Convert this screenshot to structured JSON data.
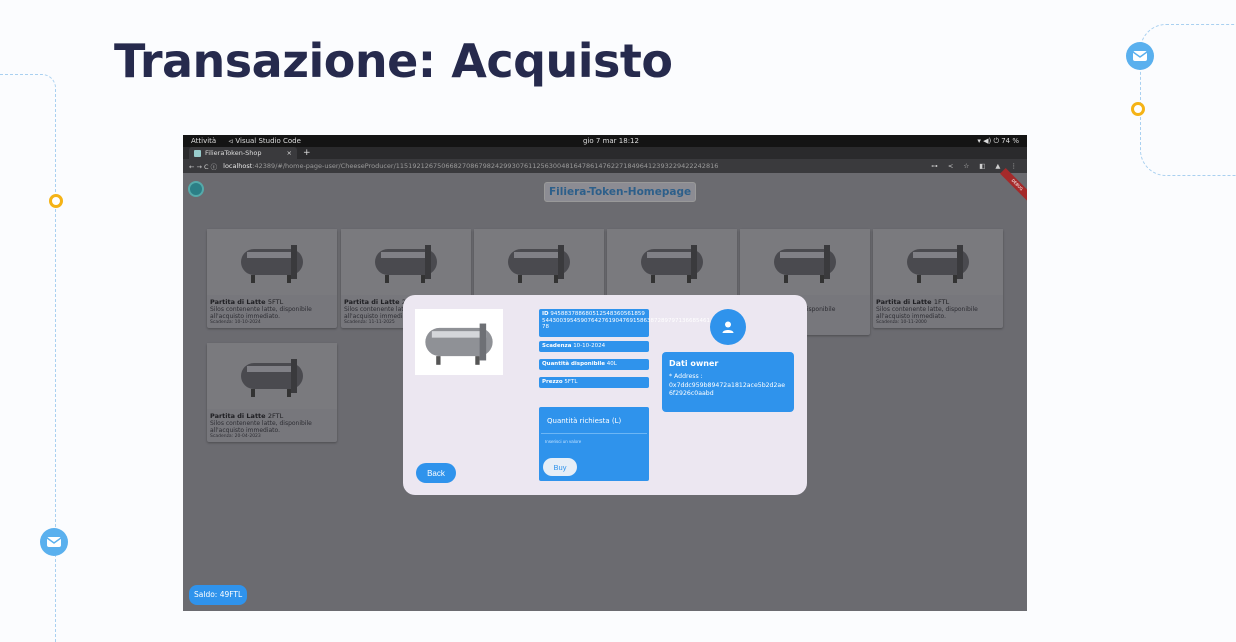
{
  "slide": {
    "title": "Transazione: Acquisto"
  },
  "os_bar": {
    "activities": "Attività",
    "app": "⏿ Visual Studio Code",
    "clock": "gio 7 mar 18:12",
    "status": "▾ ◀) ⏻ 74 %"
  },
  "browser": {
    "tab_title": "FilieraToken-Shop",
    "tab_close": "×",
    "new_tab": "+",
    "nav": "← → C ⓘ",
    "url_host": "localhost",
    "url_path": ":42389/#/home-page-user/CheeseProducer/115192126750668270867982429930761125630048164786147622718496412393229422242816",
    "right_icons": "⊶ < ☆ ◧ ▲ ⋮"
  },
  "app": {
    "home_button": "Filiera-Token-Homepage",
    "debug_ribbon": "DEBUG",
    "balance": "Saldo: 49FTL",
    "cards": [
      {
        "title": "Partita di Latte",
        "qty": "5FTL",
        "desc": "Silos contenente latte, disponibile all'acquisto immediato.",
        "exp": "Scadenza: 10-10-2024"
      },
      {
        "title": "Partita di Latte",
        "qty": "2F",
        "desc": "Silos contenente latte, disponibile all'acquisto immediato.",
        "exp": "Scadenza: 11-11-2025"
      },
      {
        "title": "",
        "qty": "",
        "desc": "",
        "exp": ""
      },
      {
        "title": "",
        "qty": "",
        "desc": "",
        "exp": ""
      },
      {
        "title": "",
        "qty": "",
        "desc": "disponibile",
        "exp": ""
      },
      {
        "title": "Partita di Latte",
        "qty": "1FTL",
        "desc": "Silos contenente latte, disponibile all'acquisto immediato.",
        "exp": "Scadenza: 10-11-2000"
      },
      {
        "title": "Partita di Latte",
        "qty": "2FTL",
        "desc": "Silos contenente latte, disponibile all'acquisto immediato.",
        "exp": "Scadenza: 20-04-2023"
      }
    ],
    "dialog": {
      "id_label": "ID",
      "id_value": "945883788680512548360561859 544300395459076427619047691586387289797136685461 78",
      "scadenza_label": "Scadenza",
      "scadenza_value": "10-10-2024",
      "quantita_label": "Quantità disponibile",
      "quantita_value": "40L",
      "prezzo_label": "Prezzo",
      "prezzo_value": "5FTL",
      "qty_requested_label": "Quantità richiesta (L)",
      "qty_placeholder": "Inserisci un valore",
      "buy_label": "Buy",
      "back_label": "Back",
      "owner_title": "Dati owner",
      "owner_address_label": "* Address :",
      "owner_address": "0x7ddc959b89472a1812ace5b2d2ae6f2926c0aabd"
    }
  }
}
